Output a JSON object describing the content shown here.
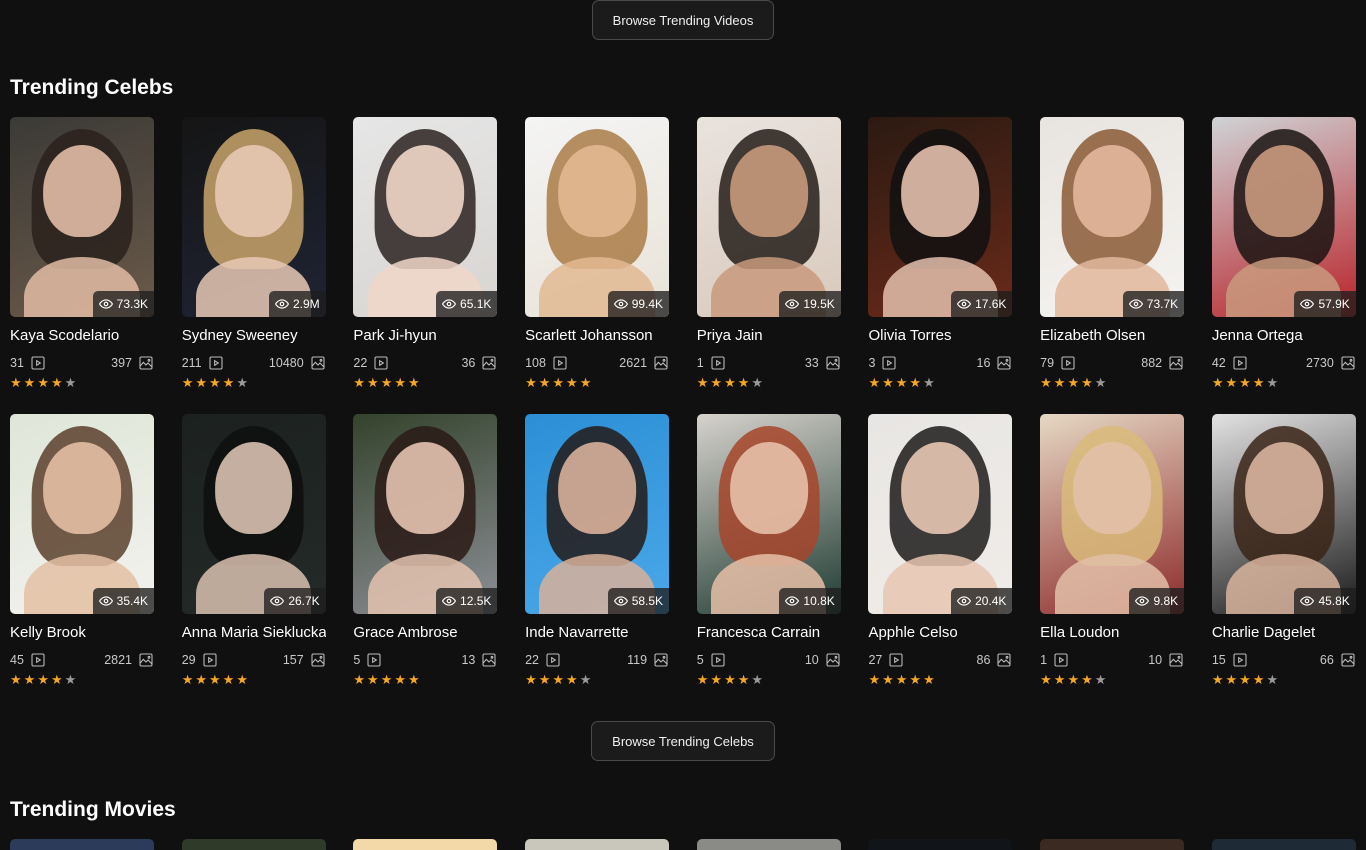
{
  "top_button": {
    "label": "Browse Trending Videos"
  },
  "celebs_section": {
    "title": "Trending Celebs"
  },
  "celebs_button": {
    "label": "Browse Trending Celebs"
  },
  "movies_section": {
    "title": "Trending Movies"
  },
  "icons": {
    "views": "eye-icon",
    "videos": "play-square-icon",
    "photos": "image-icon",
    "rating": "star-icon"
  },
  "colors": {
    "background": "#101010",
    "star_active": "#f5a623",
    "star_inactive": "#9a9a9a",
    "button_border": "#4a4a4a"
  },
  "celebs": [
    {
      "name": "Kaya Scodelario",
      "views": "73.3K",
      "videos": "31",
      "photos": "397",
      "rating": 4,
      "colors": [
        "#3b3a36",
        "#6b5a4a",
        "#e2bca5",
        "#2a211c"
      ]
    },
    {
      "name": "Sydney Sweeney",
      "views": "2.9M",
      "videos": "211",
      "photos": "10480",
      "rating": 4,
      "colors": [
        "#151515",
        "#1f2433",
        "#e7c9b5",
        "#c9a46b"
      ]
    },
    {
      "name": "Park Ji-hyun",
      "views": "65.1K",
      "videos": "22",
      "photos": "36",
      "rating": 5,
      "colors": [
        "#e6e6e6",
        "#d8d5d2",
        "#f0d6c8",
        "#2a2220"
      ]
    },
    {
      "name": "Scarlett Johansson",
      "views": "99.4K",
      "videos": "108",
      "photos": "2621",
      "rating": 5,
      "colors": [
        "#f4f4f4",
        "#e9e3d8",
        "#e2b892",
        "#a97b46"
      ]
    },
    {
      "name": "Priya Jain",
      "views": "19.5K",
      "videos": "1",
      "photos": "33",
      "rating": 4,
      "colors": [
        "#e9e3de",
        "#d9c9bc",
        "#c89a7c",
        "#231c18"
      ]
    },
    {
      "name": "Olivia Torres",
      "views": "17.6K",
      "videos": "3",
      "photos": "16",
      "rating": 4,
      "colors": [
        "#2b1a12",
        "#6a2a1a",
        "#e4c0ad",
        "#111111"
      ]
    },
    {
      "name": "Elizabeth Olsen",
      "views": "73.7K",
      "videos": "79",
      "photos": "882",
      "rating": 4,
      "colors": [
        "#e8e4df",
        "#f5f3f0",
        "#e2b79c",
        "#8a5a36"
      ]
    },
    {
      "name": "Jenna Ortega",
      "views": "57.9K",
      "videos": "42",
      "photos": "2730",
      "rating": 4,
      "colors": [
        "#cfd3d6",
        "#b8232a",
        "#c99a7e",
        "#1a1412"
      ]
    },
    {
      "name": "Kelly Brook",
      "views": "35.4K",
      "videos": "45",
      "photos": "2821",
      "rating": 4,
      "colors": [
        "#dfe6d8",
        "#f2f2ee",
        "#e3bfa3",
        "#5a3f2c"
      ]
    },
    {
      "name": "Anna Maria Sieklucka",
      "views": "26.7K",
      "videos": "29",
      "photos": "157",
      "rating": 5,
      "colors": [
        "#1c2120",
        "#232a27",
        "#d9c1b0",
        "#0e0e0e"
      ]
    },
    {
      "name": "Grace Ambrose",
      "views": "12.5K",
      "videos": "5",
      "photos": "13",
      "rating": 5,
      "colors": [
        "#34432c",
        "#8c8f96",
        "#e4c3b0",
        "#2a1a16"
      ]
    },
    {
      "name": "Inde Navarrette",
      "views": "58.5K",
      "videos": "22",
      "photos": "119",
      "rating": 4,
      "colors": [
        "#2c8fd6",
        "#4aa8e8",
        "#d8b09a",
        "#241a16"
      ]
    },
    {
      "name": "Francesca Carrain",
      "views": "10.8K",
      "videos": "5",
      "photos": "10",
      "rating": 4,
      "colors": [
        "#d6d2cc",
        "#1f3b32",
        "#e6c0a8",
        "#a6452a"
      ]
    },
    {
      "name": "Apphle Celso",
      "views": "20.4K",
      "videos": "27",
      "photos": "86",
      "rating": 5,
      "colors": [
        "#e8e6e4",
        "#f0ece8",
        "#e8c6b2",
        "#1c1a1a"
      ]
    },
    {
      "name": "Ella Loudon",
      "views": "9.8K",
      "videos": "1",
      "photos": "10",
      "rating": 4,
      "colors": [
        "#e6d8c4",
        "#8c2a2a",
        "#e2c0a8",
        "#d9bb7a"
      ]
    },
    {
      "name": "Charlie Dagelet",
      "views": "45.8K",
      "videos": "15",
      "photos": "66",
      "rating": 4,
      "colors": [
        "#e2e2e2",
        "#1a1a1a",
        "#d8b49e",
        "#3a2418"
      ]
    }
  ],
  "movies": [
    {
      "colors": [
        "#2d3b5a"
      ]
    },
    {
      "colors": [
        "#2f3a28"
      ]
    },
    {
      "colors": [
        "#f3d9a8"
      ]
    },
    {
      "colors": [
        "#c9c6bc"
      ]
    },
    {
      "colors": [
        "#8a8a86"
      ]
    },
    {
      "colors": [
        "#111418"
      ]
    },
    {
      "colors": [
        "#3a2a22"
      ]
    },
    {
      "colors": [
        "#1e2a36"
      ]
    }
  ]
}
